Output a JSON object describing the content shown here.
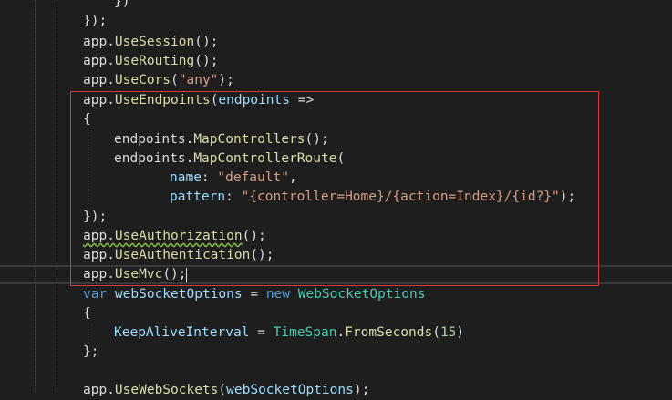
{
  "code": {
    "l0": "})",
    "l1": "});",
    "l2a": "app.",
    "l2b": "UseSession",
    "l2c": "();",
    "l3a": "app.",
    "l3b": "UseRouting",
    "l3c": "();",
    "l4a": "app.",
    "l4b": "UseCors",
    "l4c": "(",
    "l4d": "\"any\"",
    "l4e": ");",
    "l5a": "app.",
    "l5b": "UseEndpoints",
    "l5c": "(",
    "l5d": "endpoints",
    "l5e": " =>",
    "l6": "{",
    "l7a": "endpoints.",
    "l7b": "MapControllers",
    "l7c": "();",
    "l8a": "endpoints.",
    "l8b": "MapControllerRoute",
    "l8c": "(",
    "l9a": "name",
    "l9b": ": ",
    "l9c": "\"default\"",
    "l9d": ",",
    "l10a": "pattern",
    "l10b": ": ",
    "l10c": "\"{controller=Home}/{action=Index}/{id?}\"",
    "l10d": ");",
    "l11": "});",
    "l12a": "app.",
    "l12b": "UseAuthorization",
    "l12c": "();",
    "l13a": "app.",
    "l13b": "UseAuthentication",
    "l13c": "();",
    "l14a": "app.",
    "l14b": "UseMvc",
    "l14c": "();",
    "l15a": "var",
    "l15b": " webSocketOptions",
    "l15c": " = ",
    "l15d": "new",
    "l15e": " WebSocketOptions",
    "l16": "{",
    "l17a": "KeepAliveInterval",
    "l17b": " = ",
    "l17c": "TimeSpan",
    "l17d": ".",
    "l17e": "FromSeconds",
    "l17f": "(",
    "l17g": "15",
    "l17h": ")",
    "l18": "};",
    "l19a": "app.",
    "l19b": "UseWebSockets",
    "l19c": "(",
    "l19d": "webSocketOptions",
    "l19e": ");"
  },
  "colors": {
    "background": "#1e1e1e",
    "highlight_box": "#d9363e",
    "keyword": "#569cd6",
    "type": "#4ec9b0",
    "method": "#dcdcaa",
    "string": "#d69d85"
  }
}
